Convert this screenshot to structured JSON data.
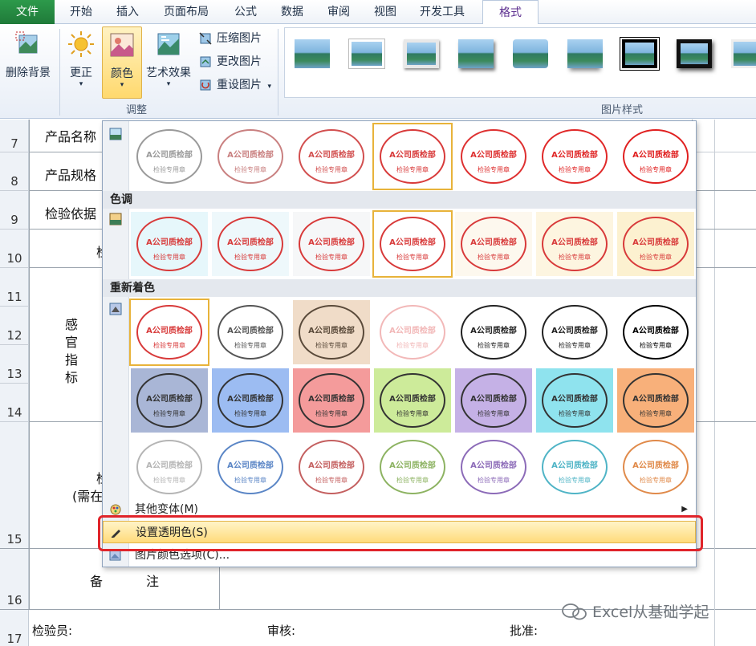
{
  "ribbon": {
    "tabs": [
      "文件",
      "开始",
      "插入",
      "页面布局",
      "公式",
      "数据",
      "审阅",
      "视图",
      "开发工具",
      "格式"
    ],
    "remove_bg": "删除背景",
    "corrections": "更正",
    "color": "颜色",
    "artistic": "艺术效果",
    "compress": "压缩图片",
    "change": "更改图片",
    "reset": "重设图片",
    "group_adjust": "调整",
    "group_styles": "图片样式"
  },
  "sheet": {
    "row_numbers": [
      "7",
      "8",
      "9",
      "10",
      "11",
      "12",
      "13",
      "14",
      "15",
      "16",
      "17"
    ],
    "cells": {
      "product_name": "产品名称",
      "product_spec": "产品规格",
      "basis": "检验依据",
      "partial_10": "检",
      "sensory_1": "感",
      "sensory_2": "官",
      "sensory_3": "指",
      "sensory_4": "标",
      "partial_15a": "检",
      "partial_15b": "(需在",
      "remark_1": "备",
      "remark_2": "注",
      "inspector": "检验员:",
      "reviewer": "审核:",
      "approver": "批准:"
    }
  },
  "dropdown": {
    "section_tone": "色调",
    "section_recolor": "重新着色",
    "stamp_line1": "A公司质检部",
    "stamp_line2": "检验专用章",
    "more_variations": "其他变体(M)",
    "set_transparent": "设置透明色(S)",
    "color_options": "图片颜色选项(C)...",
    "saturation_colors": [
      "#9a9a9a",
      "#c98080",
      "#d24f4f",
      "#d83a3a",
      "#de3030",
      "#e02828",
      "#e02020"
    ],
    "tone_bgs": [
      "#e6f7fb",
      "#eef8fb",
      "#f6f7f8",
      "#ffffff",
      "#fdf8ee",
      "#fdf5e0",
      "#fcf1d0"
    ],
    "recolor_row1": [
      {
        "bg": "#ffffff",
        "fg": "#d83a3a"
      },
      {
        "bg": "#ffffff",
        "fg": "#555555"
      },
      {
        "bg": "#f0dcc8",
        "fg": "#5a4a3a"
      },
      {
        "bg": "#ffffff",
        "fg": "#f2b8b8"
      },
      {
        "bg": "#ffffff",
        "fg": "#222222"
      },
      {
        "bg": "#ffffff",
        "fg": "#222222"
      },
      {
        "bg": "#ffffff",
        "fg": "#000000"
      }
    ],
    "recolor_row2": [
      {
        "bg": "#a9b6d6",
        "fg": "#333333"
      },
      {
        "bg": "#9cbcf2",
        "fg": "#333333"
      },
      {
        "bg": "#f49b9b",
        "fg": "#333333"
      },
      {
        "bg": "#cdeb9a",
        "fg": "#333333"
      },
      {
        "bg": "#c5b1e6",
        "fg": "#333333"
      },
      {
        "bg": "#8fe3ee",
        "fg": "#333333"
      },
      {
        "bg": "#f8b07a",
        "fg": "#333333"
      }
    ],
    "recolor_row3": [
      {
        "bg": "#ffffff",
        "fg": "#b5b5b5"
      },
      {
        "bg": "#ffffff",
        "fg": "#5b86c6"
      },
      {
        "bg": "#ffffff",
        "fg": "#c46060"
      },
      {
        "bg": "#ffffff",
        "fg": "#8db362"
      },
      {
        "bg": "#ffffff",
        "fg": "#8c6bb8"
      },
      {
        "bg": "#ffffff",
        "fg": "#4fb4c6"
      },
      {
        "bg": "#ffffff",
        "fg": "#e08a4a"
      }
    ]
  },
  "watermark": "Excel从基础学起",
  "colors": {
    "file_tab": "#217a3b",
    "highlight": "#ffdb7a",
    "red_box": "#e0242a"
  }
}
